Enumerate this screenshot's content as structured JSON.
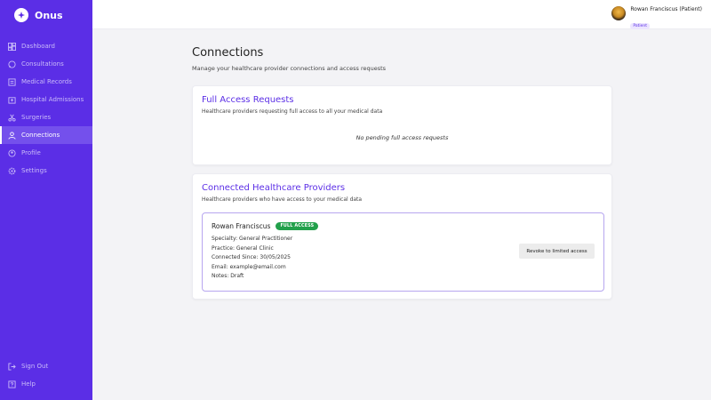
{
  "brand": {
    "name": "Onus"
  },
  "sidebar": {
    "items": [
      {
        "label": "Dashboard",
        "icon": "dashboard-icon"
      },
      {
        "label": "Consultations",
        "icon": "chat-icon"
      },
      {
        "label": "Medical Records",
        "icon": "records-icon"
      },
      {
        "label": "Hospital Admissions",
        "icon": "hospital-icon"
      },
      {
        "label": "Surgeries",
        "icon": "scissors-icon"
      },
      {
        "label": "Connections",
        "icon": "user-icon",
        "active": true
      },
      {
        "label": "Profile",
        "icon": "profile-icon"
      },
      {
        "label": "Settings",
        "icon": "gear-icon"
      }
    ],
    "bottom": [
      {
        "label": "Sign Out",
        "icon": "sign-out-icon"
      },
      {
        "label": "Help",
        "icon": "help-icon"
      }
    ]
  },
  "user": {
    "name": "Rowan Franciscus (Patient)",
    "role": "Patient"
  },
  "page": {
    "title": "Connections",
    "subtitle": "Manage your healthcare provider connections and access requests"
  },
  "full_access": {
    "title": "Full Access Requests",
    "subtitle": "Healthcare providers requesting full access to all your medical data",
    "empty_message": "No pending full access requests"
  },
  "connected": {
    "title": "Connected Healthcare Providers",
    "subtitle": "Healthcare providers who have access to your medical data",
    "provider": {
      "name": "Rowan Franciscus",
      "badge": "FULL ACCESS",
      "specialty": "Specialty: General Practitioner",
      "practice": "Practice: General Clinic",
      "connected_since": "Connected Since: 30/05/2025",
      "email": "Email: example@email.com",
      "notes": "Notes: Draft",
      "revoke_label": "Revoke to limited access"
    }
  },
  "colors": {
    "accent": "#5b2ee6",
    "badge_green": "#22a04b"
  }
}
